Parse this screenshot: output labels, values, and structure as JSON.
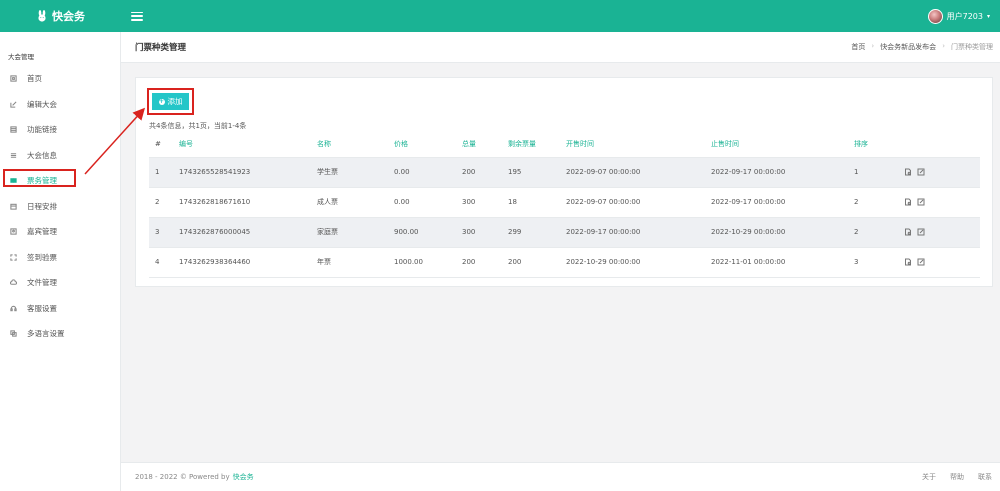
{
  "header": {
    "logo": "快会务",
    "user": "用户7203"
  },
  "sidebar": {
    "section_title": "大会管理",
    "items": [
      {
        "label": "首页",
        "icon": "home-icon"
      },
      {
        "label": "编辑大会",
        "icon": "edit-icon"
      },
      {
        "label": "功能链接",
        "icon": "grid-icon"
      },
      {
        "label": "大会信息",
        "icon": "list-icon"
      },
      {
        "label": "票务管理",
        "icon": "ticket-icon",
        "active": true
      },
      {
        "label": "日程安排",
        "icon": "calendar-icon"
      },
      {
        "label": "嘉宾管理",
        "icon": "id-card-icon"
      },
      {
        "label": "签到验票",
        "icon": "qr-scan-icon"
      },
      {
        "label": "文件管理",
        "icon": "cloud-icon"
      },
      {
        "label": "客服设置",
        "icon": "headset-icon"
      },
      {
        "label": "多语言设置",
        "icon": "language-icon"
      }
    ]
  },
  "page": {
    "title": "门票种类管理",
    "breadcrumb": [
      "首页",
      "快会务新品发布会",
      "门票种类管理"
    ]
  },
  "toolbar": {
    "add_label": "添加"
  },
  "summary": "共4条信息，共1页，当前1-4条",
  "table": {
    "columns": [
      "#",
      "编号",
      "名称",
      "价格",
      "总量",
      "剩余票量",
      "开售时间",
      "止售时间",
      "排序"
    ],
    "rows": [
      [
        "1",
        "1743265528541923",
        "学生票",
        "0.00",
        "200",
        "195",
        "2022-09-07 00:00:00",
        "2022-09-17 00:00:00",
        "1"
      ],
      [
        "2",
        "1743262818671610",
        "成人票",
        "0.00",
        "300",
        "18",
        "2022-09-07 00:00:00",
        "2022-09-17 00:00:00",
        "2"
      ],
      [
        "3",
        "1743262876000045",
        "家庭票",
        "900.00",
        "300",
        "299",
        "2022-09-17 00:00:00",
        "2022-10-29 00:00:00",
        "2"
      ],
      [
        "4",
        "1743262938364460",
        "年票",
        "1000.00",
        "200",
        "200",
        "2022-10-29 00:00:00",
        "2022-11-01 00:00:00",
        "3"
      ]
    ]
  },
  "footer": {
    "copyright": "2018 - 2022 © Powered by",
    "brand": "快会务",
    "links": [
      "关于",
      "帮助",
      "联系"
    ]
  },
  "colors": {
    "accent": "#1ab394",
    "button": "#23c6c8",
    "annotation": "#d9231e"
  }
}
